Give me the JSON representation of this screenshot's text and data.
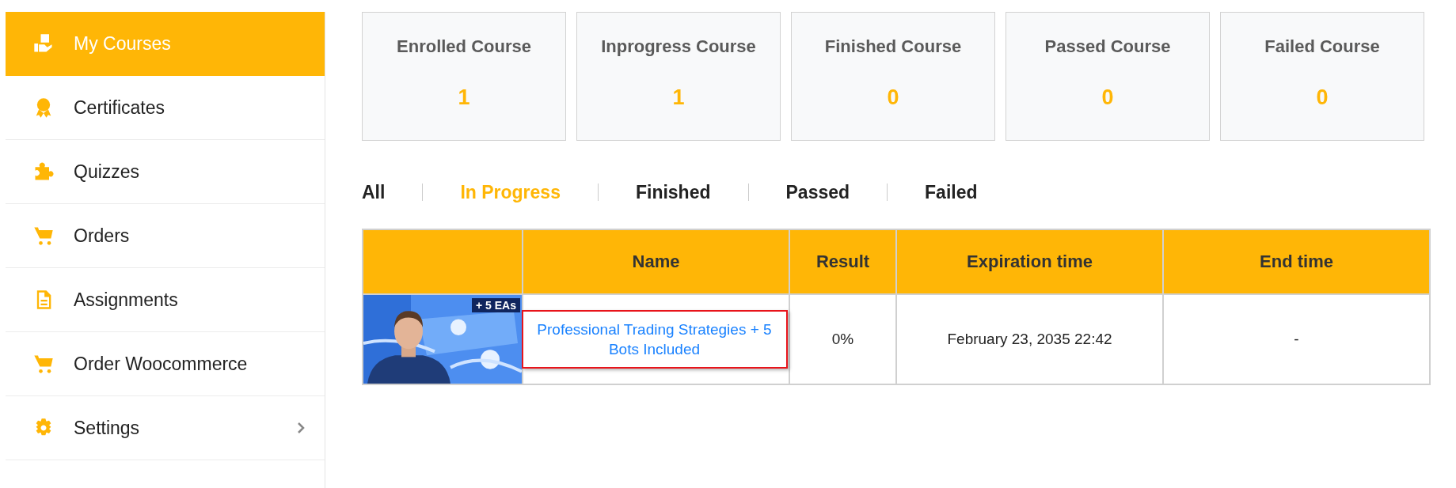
{
  "sidebar": {
    "items": [
      {
        "label": "My Courses",
        "kind": "courses",
        "selected": true
      },
      {
        "label": "Certificates",
        "kind": "certificate",
        "selected": false
      },
      {
        "label": "Quizzes",
        "kind": "puzzle",
        "selected": false
      },
      {
        "label": "Orders",
        "kind": "cart",
        "selected": false
      },
      {
        "label": "Assignments",
        "kind": "document",
        "selected": false
      },
      {
        "label": "Order Woocommerce",
        "kind": "cart",
        "selected": false
      },
      {
        "label": "Settings",
        "kind": "gear",
        "selected": false,
        "expandable": true
      }
    ]
  },
  "stats": [
    {
      "label": "Enrolled Course",
      "value": "1"
    },
    {
      "label": "Inprogress Course",
      "value": "1"
    },
    {
      "label": "Finished Course",
      "value": "0"
    },
    {
      "label": "Passed Course",
      "value": "0"
    },
    {
      "label": "Failed Course",
      "value": "0"
    }
  ],
  "filter_tabs": [
    {
      "label": "All",
      "selected": false
    },
    {
      "label": "In Progress",
      "selected": true
    },
    {
      "label": "Finished",
      "selected": false
    },
    {
      "label": "Passed",
      "selected": false
    },
    {
      "label": "Failed",
      "selected": false
    }
  ],
  "table": {
    "columns": [
      "Name",
      "Result",
      "Expiration time",
      "End time"
    ],
    "rows": [
      {
        "thumbnail": {
          "kind": "picture",
          "badge": "+ 5 EAs"
        },
        "name": "Professional Trading Strategies + 5 Bots Included",
        "focused": true,
        "result": "0%",
        "expiration_time": "February 23, 2035 22:42",
        "end_time": "-"
      }
    ]
  }
}
